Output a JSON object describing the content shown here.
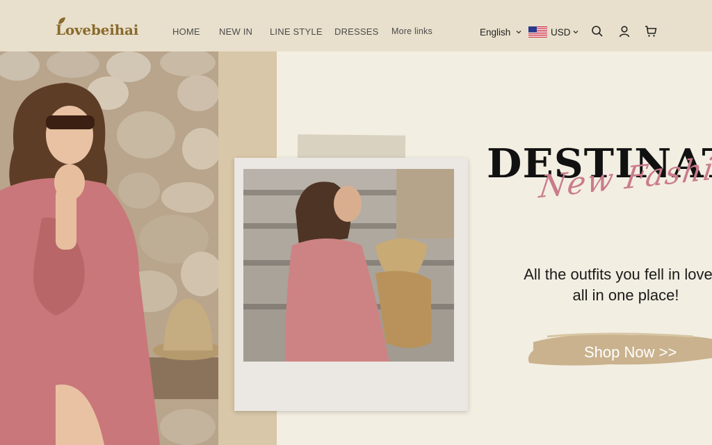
{
  "brand": {
    "name": "Lovebeihai",
    "color": "#8a6a2c"
  },
  "nav": {
    "items": [
      {
        "label": "HOME"
      },
      {
        "label": "NEW IN"
      },
      {
        "label": "LINE STYLE"
      },
      {
        "label": "DRESSES"
      },
      {
        "label": "More links"
      }
    ]
  },
  "header_actions": {
    "language": "English",
    "currency": "USD",
    "currency_flag": "us-flag-icon",
    "icons": [
      "search-icon",
      "account-icon",
      "cart-icon"
    ]
  },
  "hero": {
    "headline": "DESTINAT",
    "script_text": "New Fashion",
    "tagline_line1": "All the outfits you fell in love w",
    "tagline_line2": "all in one place!",
    "cta_label": "Shop Now >>",
    "colors": {
      "header_bg": "#e8e0cc",
      "paper": "#f3eee2",
      "script": "#c97c8c",
      "brush": "#c9b28d"
    }
  }
}
